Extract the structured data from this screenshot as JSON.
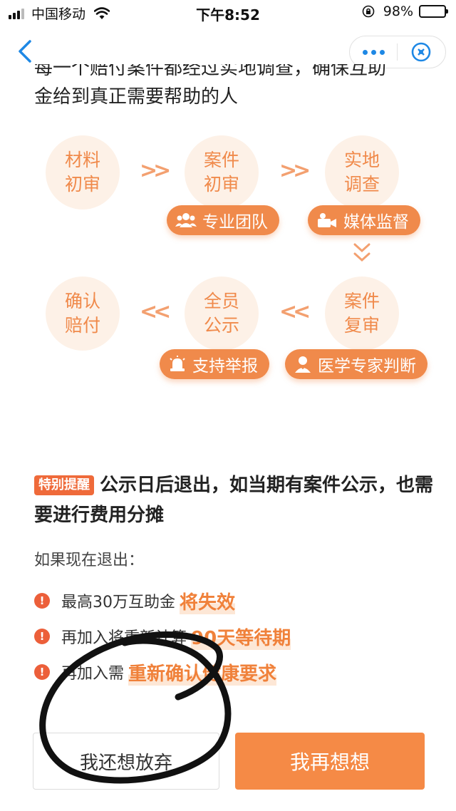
{
  "status_bar": {
    "carrier": "中国移动",
    "time": "下午8:52",
    "battery_pct": "98%",
    "battery_level": 0.98
  },
  "nav": {
    "back_icon": "chevron-left-icon",
    "more_icon": "more-dots-icon",
    "close_icon": "close-target-icon"
  },
  "intro": {
    "line_cut": "每一个赔付案件都经过实地调查，确保互助",
    "line2": "金给到真正需要帮助的人"
  },
  "process": {
    "steps": [
      {
        "label": "材料初审"
      },
      {
        "label": "案件初审"
      },
      {
        "label": "实地调查"
      },
      {
        "label": "确认赔付"
      },
      {
        "label": "全员公示"
      },
      {
        "label": "案件复审"
      }
    ],
    "arrows": {
      "forward": ">>",
      "backward": "<<"
    },
    "tags": [
      {
        "label": "专业团队",
        "icon": "team-icon"
      },
      {
        "label": "媒体监督",
        "icon": "video-camera-icon"
      },
      {
        "label": "支持举报",
        "icon": "alarm-bell-icon"
      },
      {
        "label": "医学专家判断",
        "icon": "doctor-icon"
      }
    ]
  },
  "reminder": {
    "badge": "特别提醒",
    "headline": "公示日后退出，如当期有案件公示，也需要进行费用分摊"
  },
  "exit_intro": "如果现在退出：",
  "consequences": [
    {
      "text": "最高30万互助金",
      "highlight": "将失效"
    },
    {
      "text": "再加入将重新计算",
      "highlight": "90天等待期"
    },
    {
      "text": "再加入需",
      "highlight": "重新确认健康要求"
    }
  ],
  "buttons": {
    "give_up": "我还想放弃",
    "rethink": "我再想想"
  },
  "colors": {
    "accent": "#f58a46",
    "step_bg": "#fdf1e7",
    "badge": "#ef6a3a",
    "nav_blue": "#1e88e5"
  }
}
